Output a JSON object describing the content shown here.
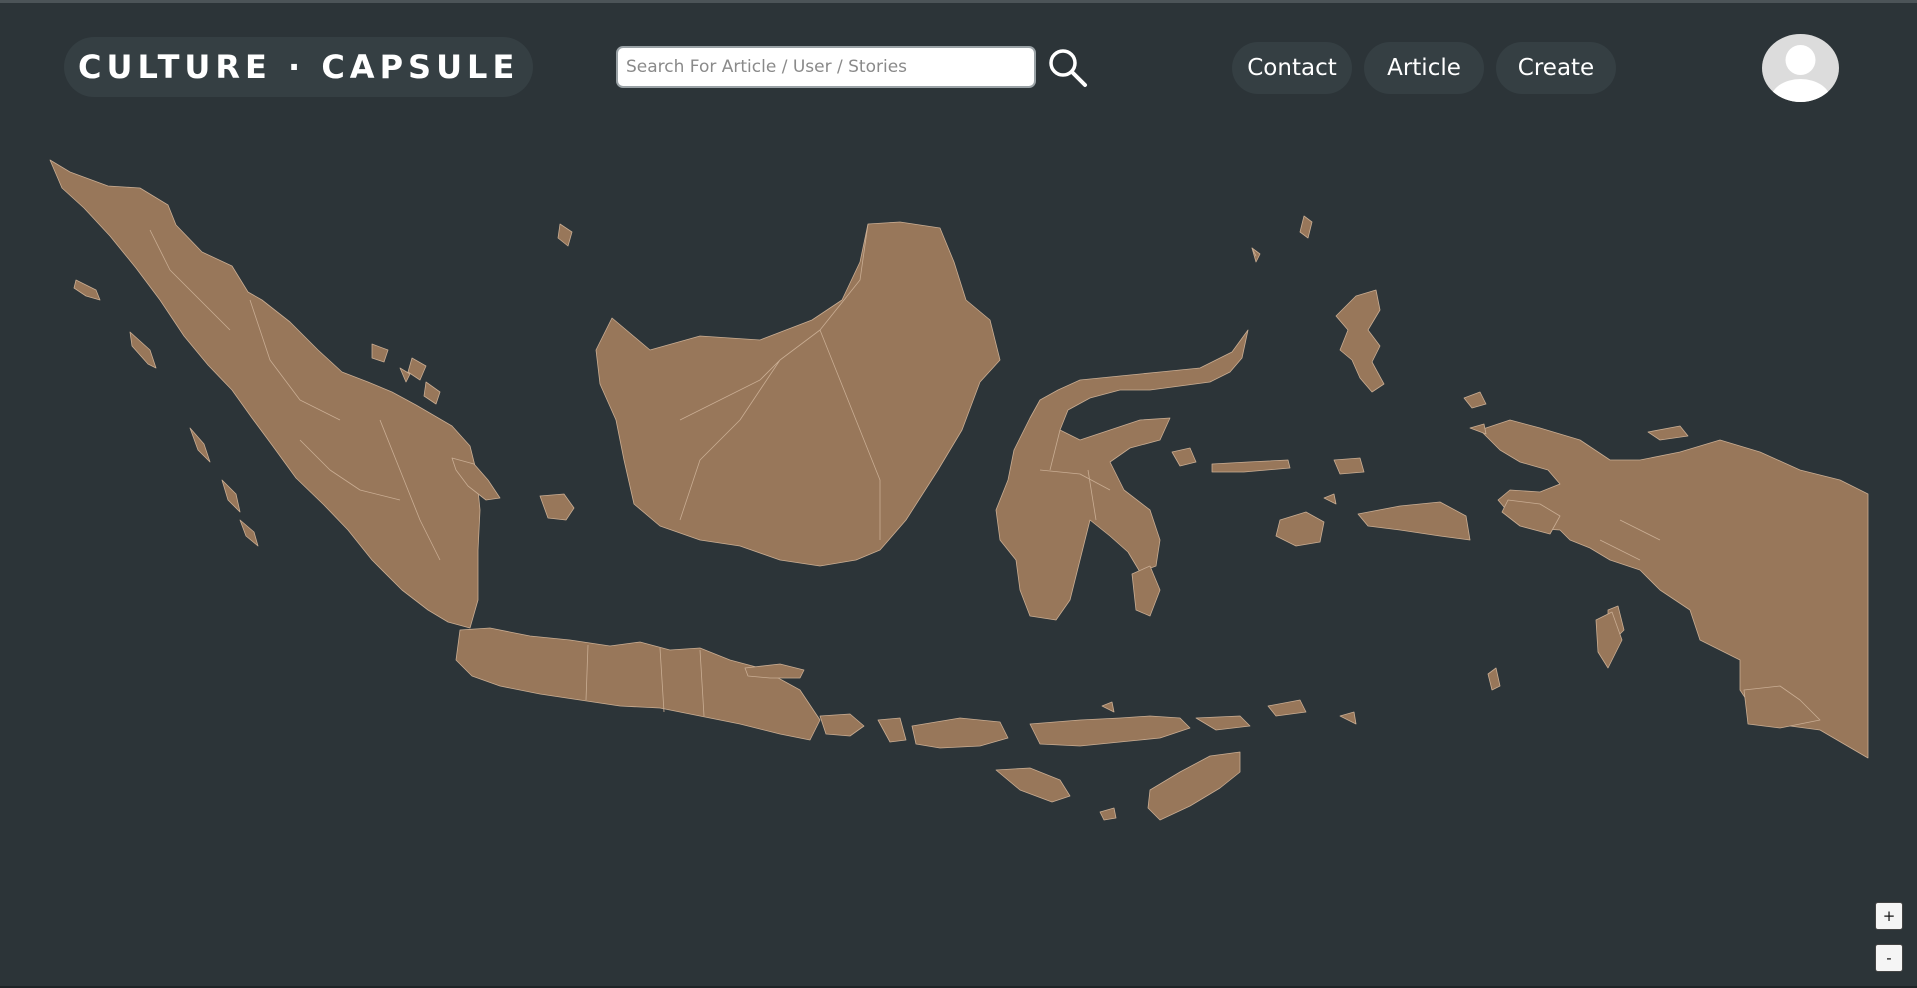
{
  "app": {
    "logo_text": "CULTURE · CAPSULE"
  },
  "search": {
    "placeholder": "Search For Article / User / Stories",
    "value": "",
    "icon": "search-icon"
  },
  "nav": {
    "contact_label": "Contact",
    "article_label": "Article",
    "create_label": "Create"
  },
  "user": {
    "avatar_icon": "user-avatar-icon"
  },
  "map": {
    "region": "Indonesia",
    "land_color": "#98775a",
    "border_color": "#c9ad93",
    "background_color": "#2c3438"
  },
  "zoom": {
    "in_label": "+",
    "out_label": "-"
  }
}
